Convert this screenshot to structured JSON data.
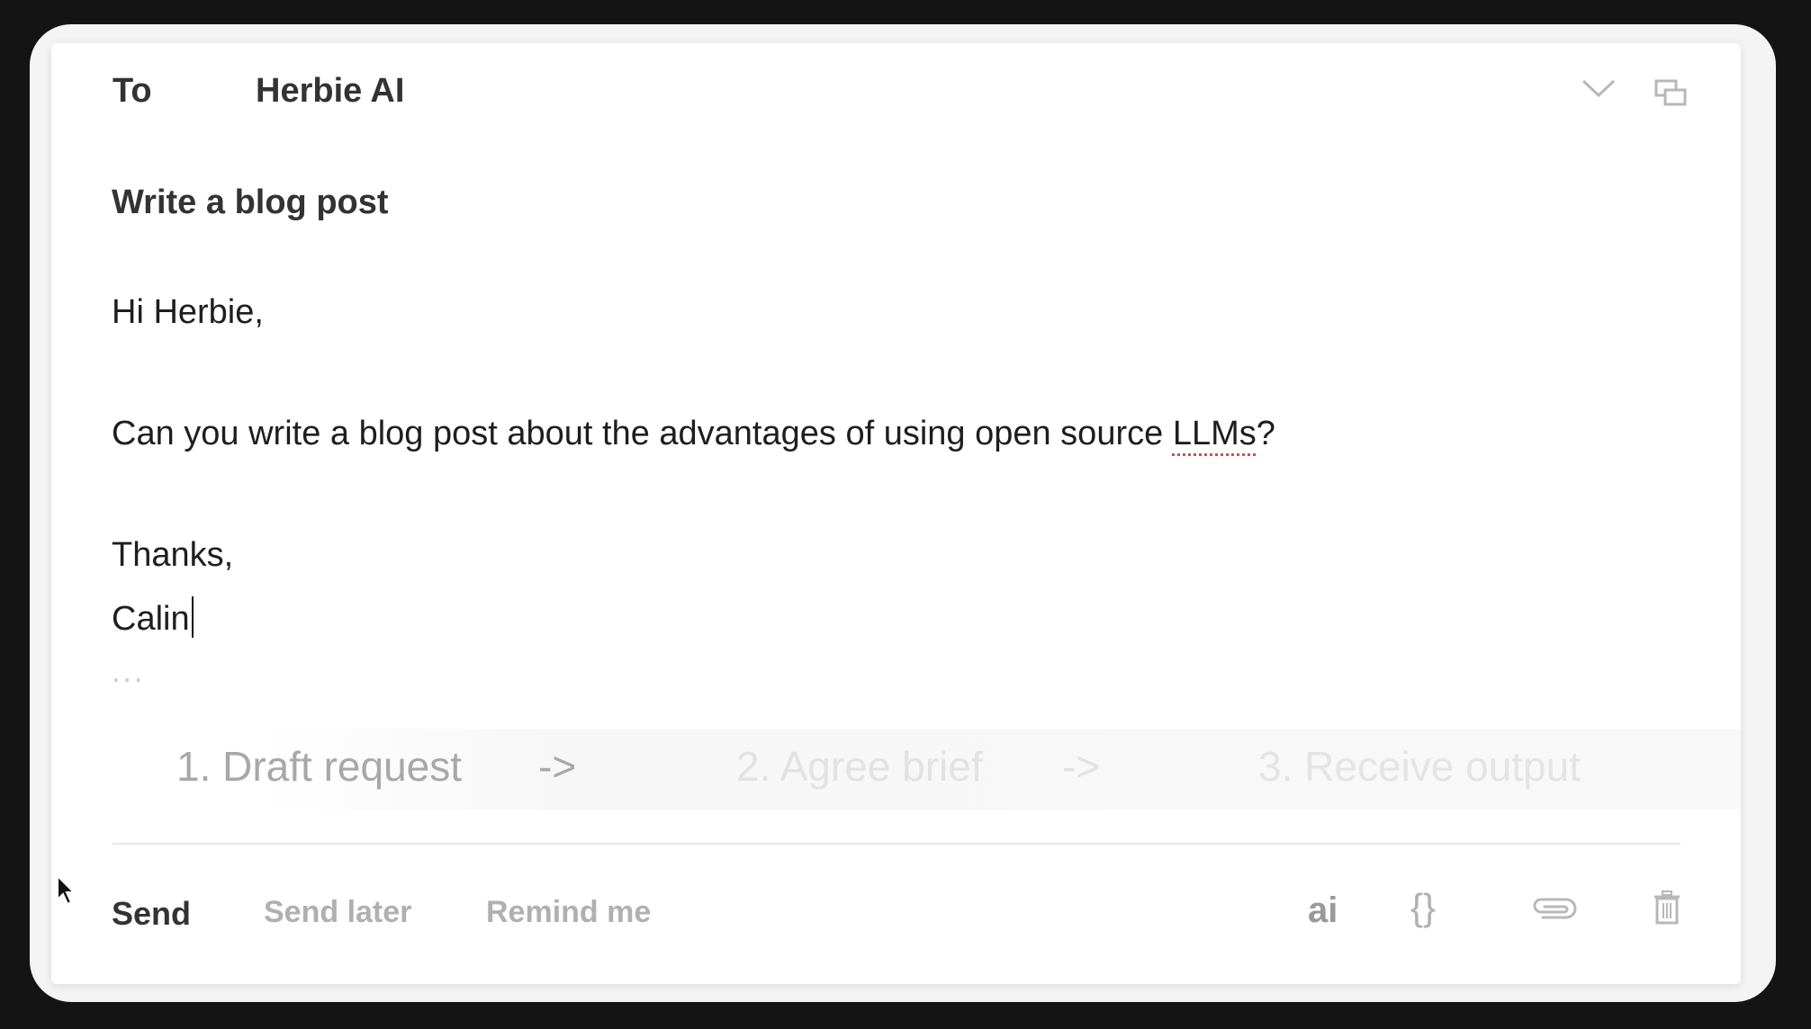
{
  "header": {
    "to_label": "To",
    "to_value": "Herbie AI",
    "icons": [
      "chevron-down-icon",
      "popout-window-icon"
    ]
  },
  "subject": "Write a blog post",
  "body": {
    "greeting": "Hi Herbie,",
    "message_before": "Can you write a blog post about the advantages of using open source ",
    "message_flagged_word": "LLMs",
    "message_after": "?",
    "signoff": "Thanks,",
    "signature": "Calin",
    "more_indicator": "..."
  },
  "steps": {
    "step1": "1. Draft request",
    "arrow1": "->",
    "step2": "2. Agree brief",
    "arrow2": "->",
    "step3": "3. Receive output"
  },
  "footer": {
    "send_label": "Send",
    "send_later_label": "Send later",
    "remind_label": "Remind me",
    "ai_label": "ai",
    "braces_label": "{}",
    "icons": [
      "paperclip-icon",
      "trash-icon"
    ]
  },
  "colors": {
    "background": "#141414",
    "card": "#ffffff",
    "spellcheck_underline": "#d05050"
  }
}
